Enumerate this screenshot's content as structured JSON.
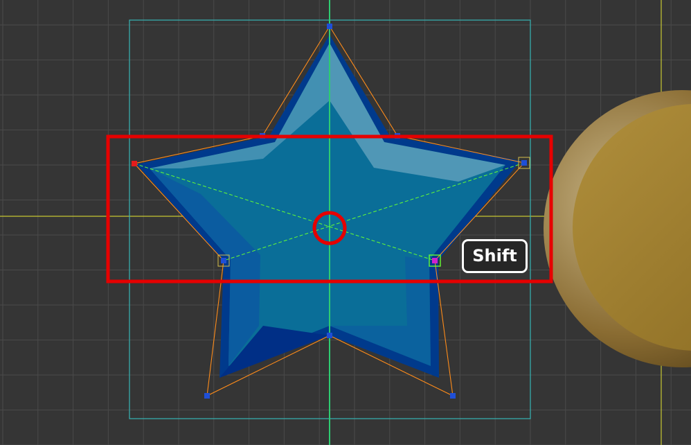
{
  "colors": {
    "background": "#353535",
    "grid": "#4a4a4a",
    "axis_y": "#2ecc71",
    "axis_x": "#c8c832",
    "bounds": "#36b5b5",
    "star_fill": "#0a6e98",
    "star_dark": "#003a8c",
    "star_light": "#3f92b4",
    "control_lines": "#ff8c1a",
    "handle": "#1f4fd6",
    "selected_handle": "#e51c1c",
    "pivot_handle": "#d020d0",
    "diagonal_guides": "#66ff33",
    "highlight_box": "#e60000",
    "coin": "#a8832e"
  },
  "annotation": {
    "key_badge_label": "Shift",
    "highlight_box_color": "#e60000",
    "center_marker_color": "#e60000"
  },
  "icons": [
    "center-circle-icon",
    "vertex-handle-icon"
  ]
}
